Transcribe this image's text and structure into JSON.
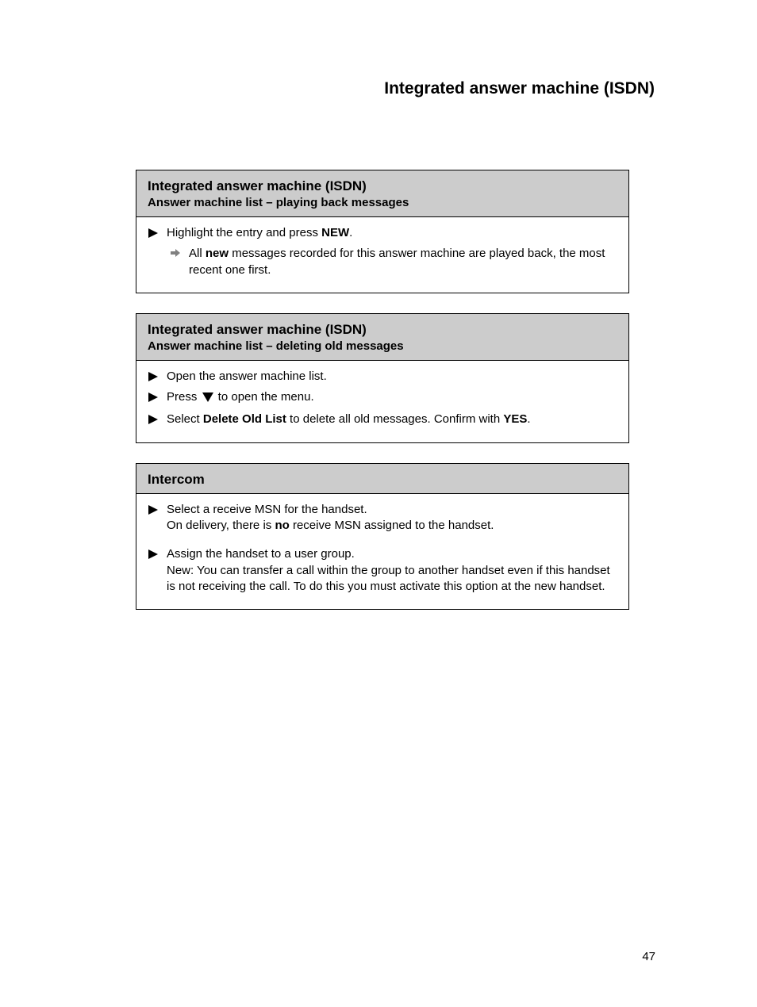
{
  "page": {
    "title": "Integrated answer machine (ISDN)",
    "number": "47"
  },
  "box1": {
    "h1": "Integrated answer machine (ISDN)",
    "h2": "Answer machine list – playing back messages",
    "step1": "Highlight the entry and press ",
    "step1_key": "NEW",
    "step1_after": ".",
    "result_pre": "All ",
    "result_bold": "new",
    "result_after": " messages recorded for this answer machine are played back, the most recent one first."
  },
  "box2": {
    "h1": "Integrated answer machine (ISDN)",
    "h2": "Answer machine list – deleting old messages",
    "step1": "Open the answer machine list.",
    "step2_pre": "Press ",
    "step2_after": " to open the menu.",
    "step3_pre": "Select ",
    "step3_bold": "Delete Old List",
    "step3_after": " to delete all old messages.",
    "step4_pre": "Confirm with ",
    "step4_key": "YES",
    "step4_after": "."
  },
  "box3": {
    "h1": "Intercom",
    "step1": "Select a receive MSN for the handset.",
    "step1_cont_pre": "On delivery, there is ",
    "step1_cont_bold": "no",
    "step1_cont_after": " receive MSN assigned to the handset.",
    "step2": "Assign the handset to a user group.",
    "step2_cont": "New: You can transfer a call within the group to another handset even if this handset is not receiving the call. To do this you must activate this option at the new handset."
  }
}
